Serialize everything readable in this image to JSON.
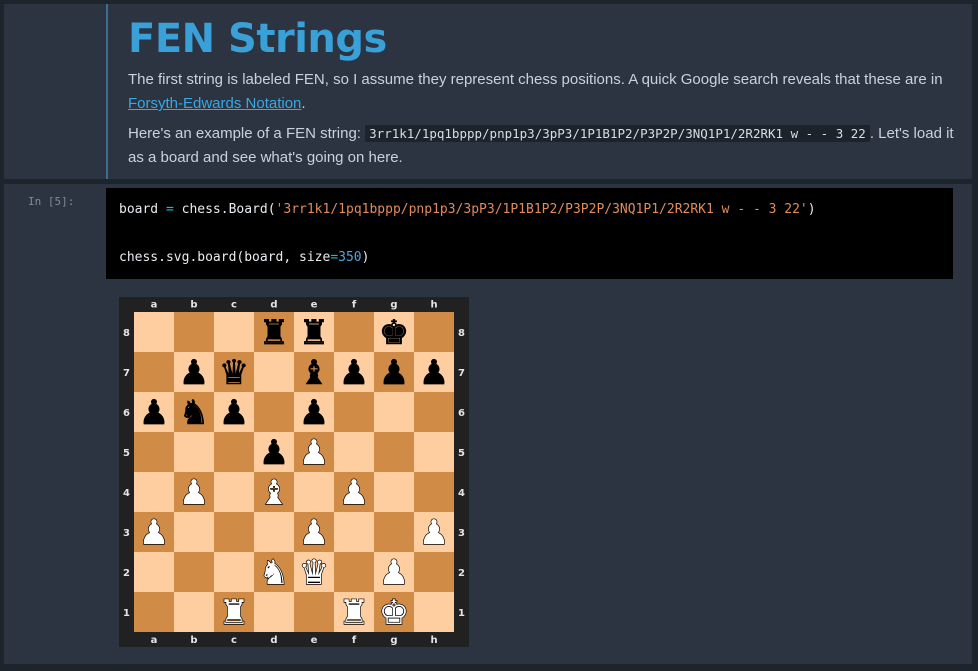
{
  "markdown": {
    "title": "FEN Strings",
    "p1_text": "The first string is labeled FEN, so I assume they represent chess positions. A quick Google search reveals that these are in ",
    "p1_link": "Forsyth-Edwards Notation",
    "p1_end": ".",
    "p2_start": "Here's an example of a FEN string: ",
    "p2_code": "3rr1k1/1pq1bppp/pnp1p3/3pP3/1P1B1P2/P3P2P/3NQ1P1/2R2RK1 w - - 3 22",
    "p2_end": ". Let's load it as a board and see what's going on here."
  },
  "code_cell": {
    "prompt": "In [5]:",
    "line1": {
      "var": "board",
      "op": "=",
      "call": "chess.Board(",
      "arg": "'3rr1k1/1pq1bppp/pnp1p3/3pP3/1P1B1P2/P3P2P/3NQ1P1/2R2RK1 w - - 3 22'",
      "close": ")"
    },
    "line2": {
      "call": "chess.svg.board(board, size",
      "op": "=",
      "num": "350",
      "close": ")"
    }
  },
  "board": {
    "files": [
      "a",
      "b",
      "c",
      "d",
      "e",
      "f",
      "g",
      "h"
    ],
    "ranks": [
      "8",
      "7",
      "6",
      "5",
      "4",
      "3",
      "2",
      "1"
    ],
    "fen": "3rr1k1/1pq1bppp/pnp1p3/3pP3/1P1B1P2/P3P2P/3NQ1P1/2R2RK1",
    "light_square": "#fecea0",
    "dark_square": "#d08b47",
    "border": "#212121",
    "coord_color": "#e5e5e5"
  }
}
